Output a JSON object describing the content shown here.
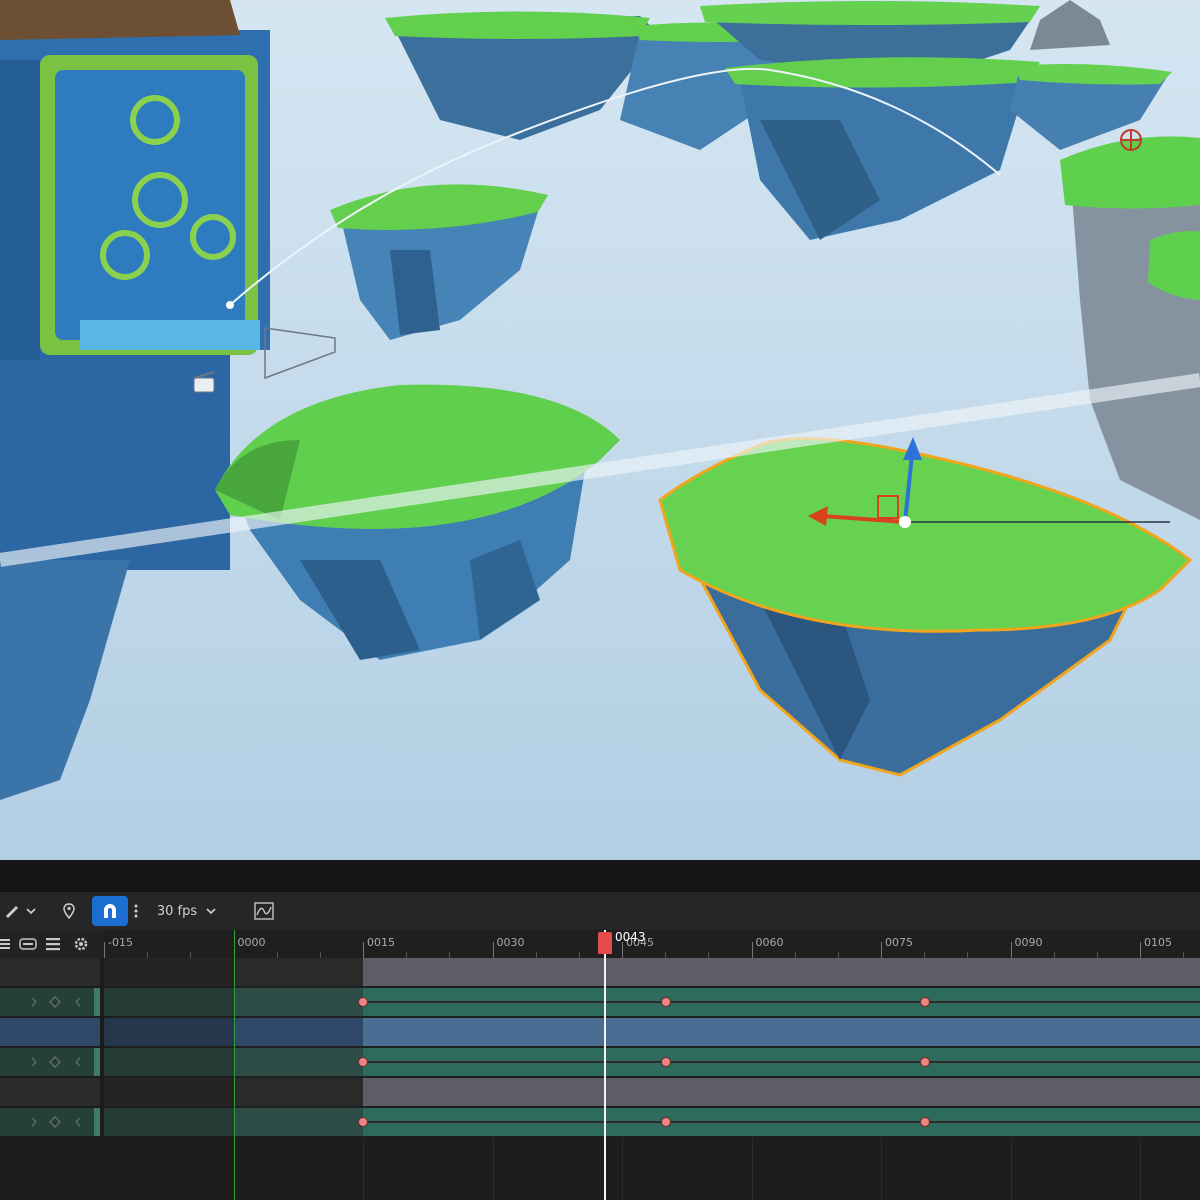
{
  "toolbar": {
    "fps_label": "30 fps",
    "icons": [
      "brush-icon",
      "chevron-down-icon",
      "location-pin-icon",
      "magnet-icon",
      "more-vert-icon",
      "chevron-down-icon",
      "curve-editor-icon"
    ]
  },
  "timeline": {
    "tick_labels": [
      "-015",
      "0000",
      "0015",
      "0030",
      "0045",
      "0060",
      "0075",
      "0090",
      "0105"
    ],
    "current_frame": "0043"
  },
  "colors": {
    "accent_blue": "#1b6fd1",
    "playhead_red": "#e64b4b",
    "key_color": "#f08282",
    "island_grass": "#5fd04d",
    "rock_blue": "#3f7fb0"
  }
}
